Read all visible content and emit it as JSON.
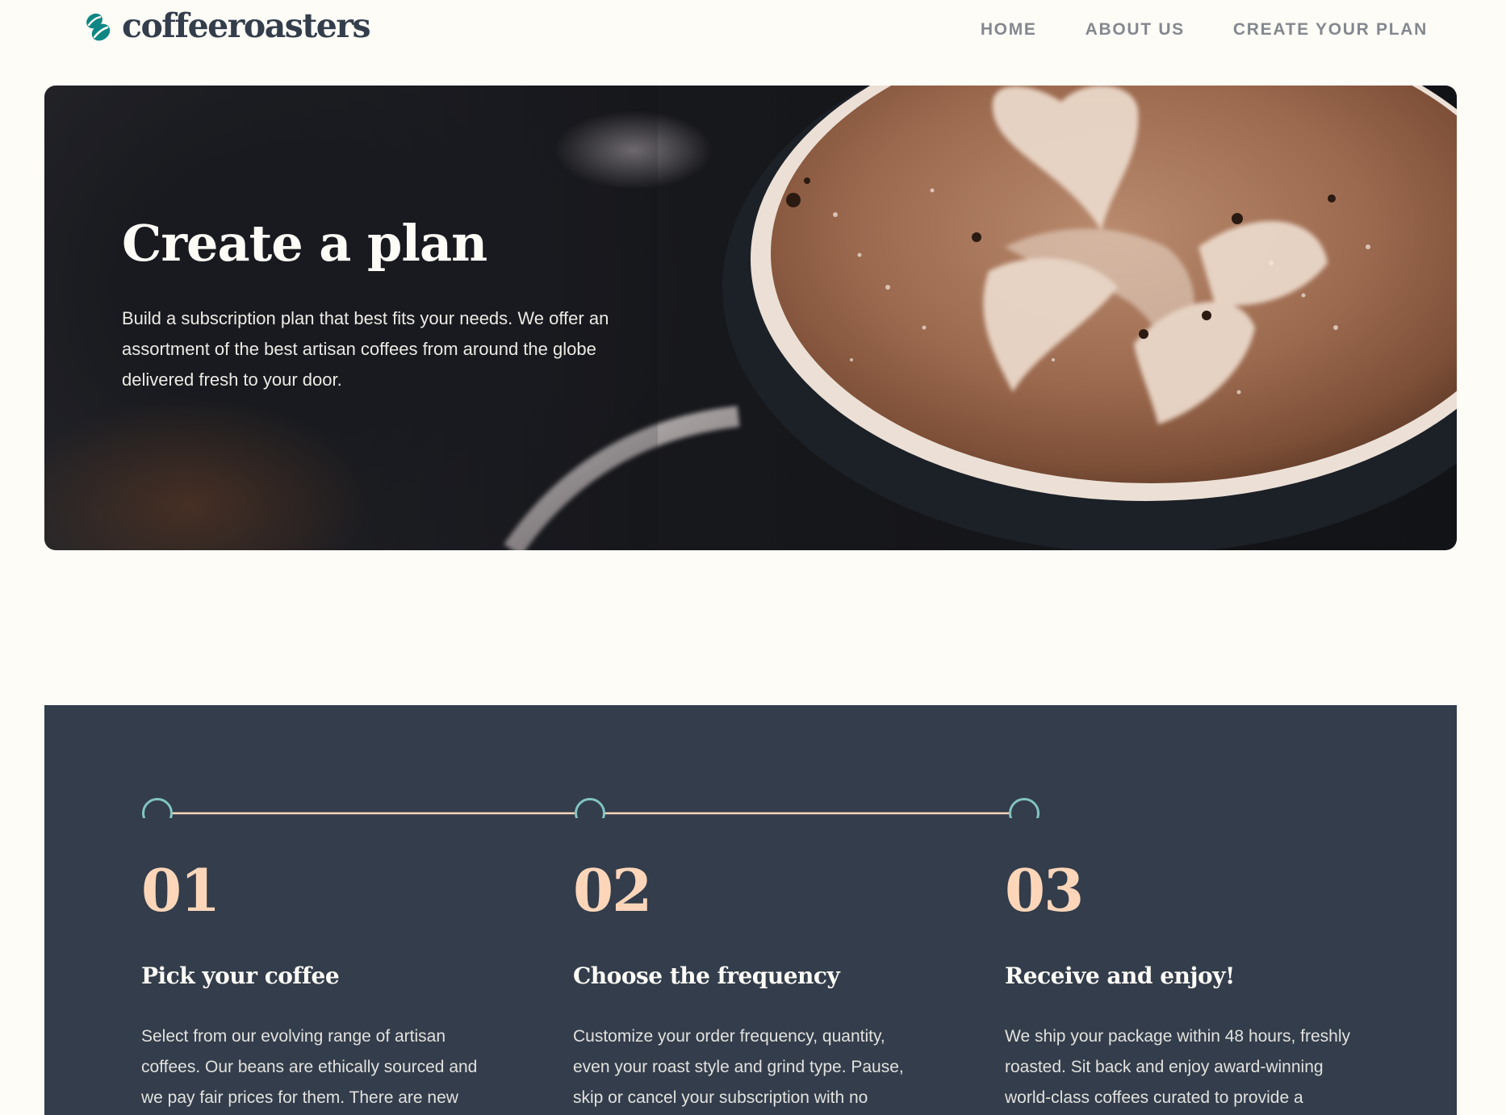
{
  "brand": {
    "name": "coffeeroasters",
    "accent_color": "#0E8784",
    "dark_color": "#333D4B",
    "peach_color": "#FDD6BA",
    "cream_color": "#FEFCF7"
  },
  "nav": {
    "items": [
      {
        "label": "HOME"
      },
      {
        "label": "ABOUT US"
      },
      {
        "label": "CREATE YOUR PLAN"
      }
    ]
  },
  "hero": {
    "title": "Create a plan",
    "description": "Build a subscription plan that best fits your needs. We offer an assortment of the best artisan coffees from around the globe delivered fresh to your door.",
    "image": "latte-art-coffee-cup"
  },
  "steps": {
    "items": [
      {
        "number": "01",
        "title": "Pick your coffee",
        "text": "Select from our evolving range of artisan coffees. Our beans are ethically sourced and we pay fair prices for them. There are new"
      },
      {
        "number": "02",
        "title": "Choose the frequency",
        "text": "Customize your order frequency, quantity, even your roast style and grind type. Pause, skip or cancel your subscription with no"
      },
      {
        "number": "03",
        "title": "Receive and enjoy!",
        "text": "We ship your package within 48 hours, freshly roasted. Sit back and enjoy award-winning world-class coffees curated to provide a"
      }
    ]
  }
}
